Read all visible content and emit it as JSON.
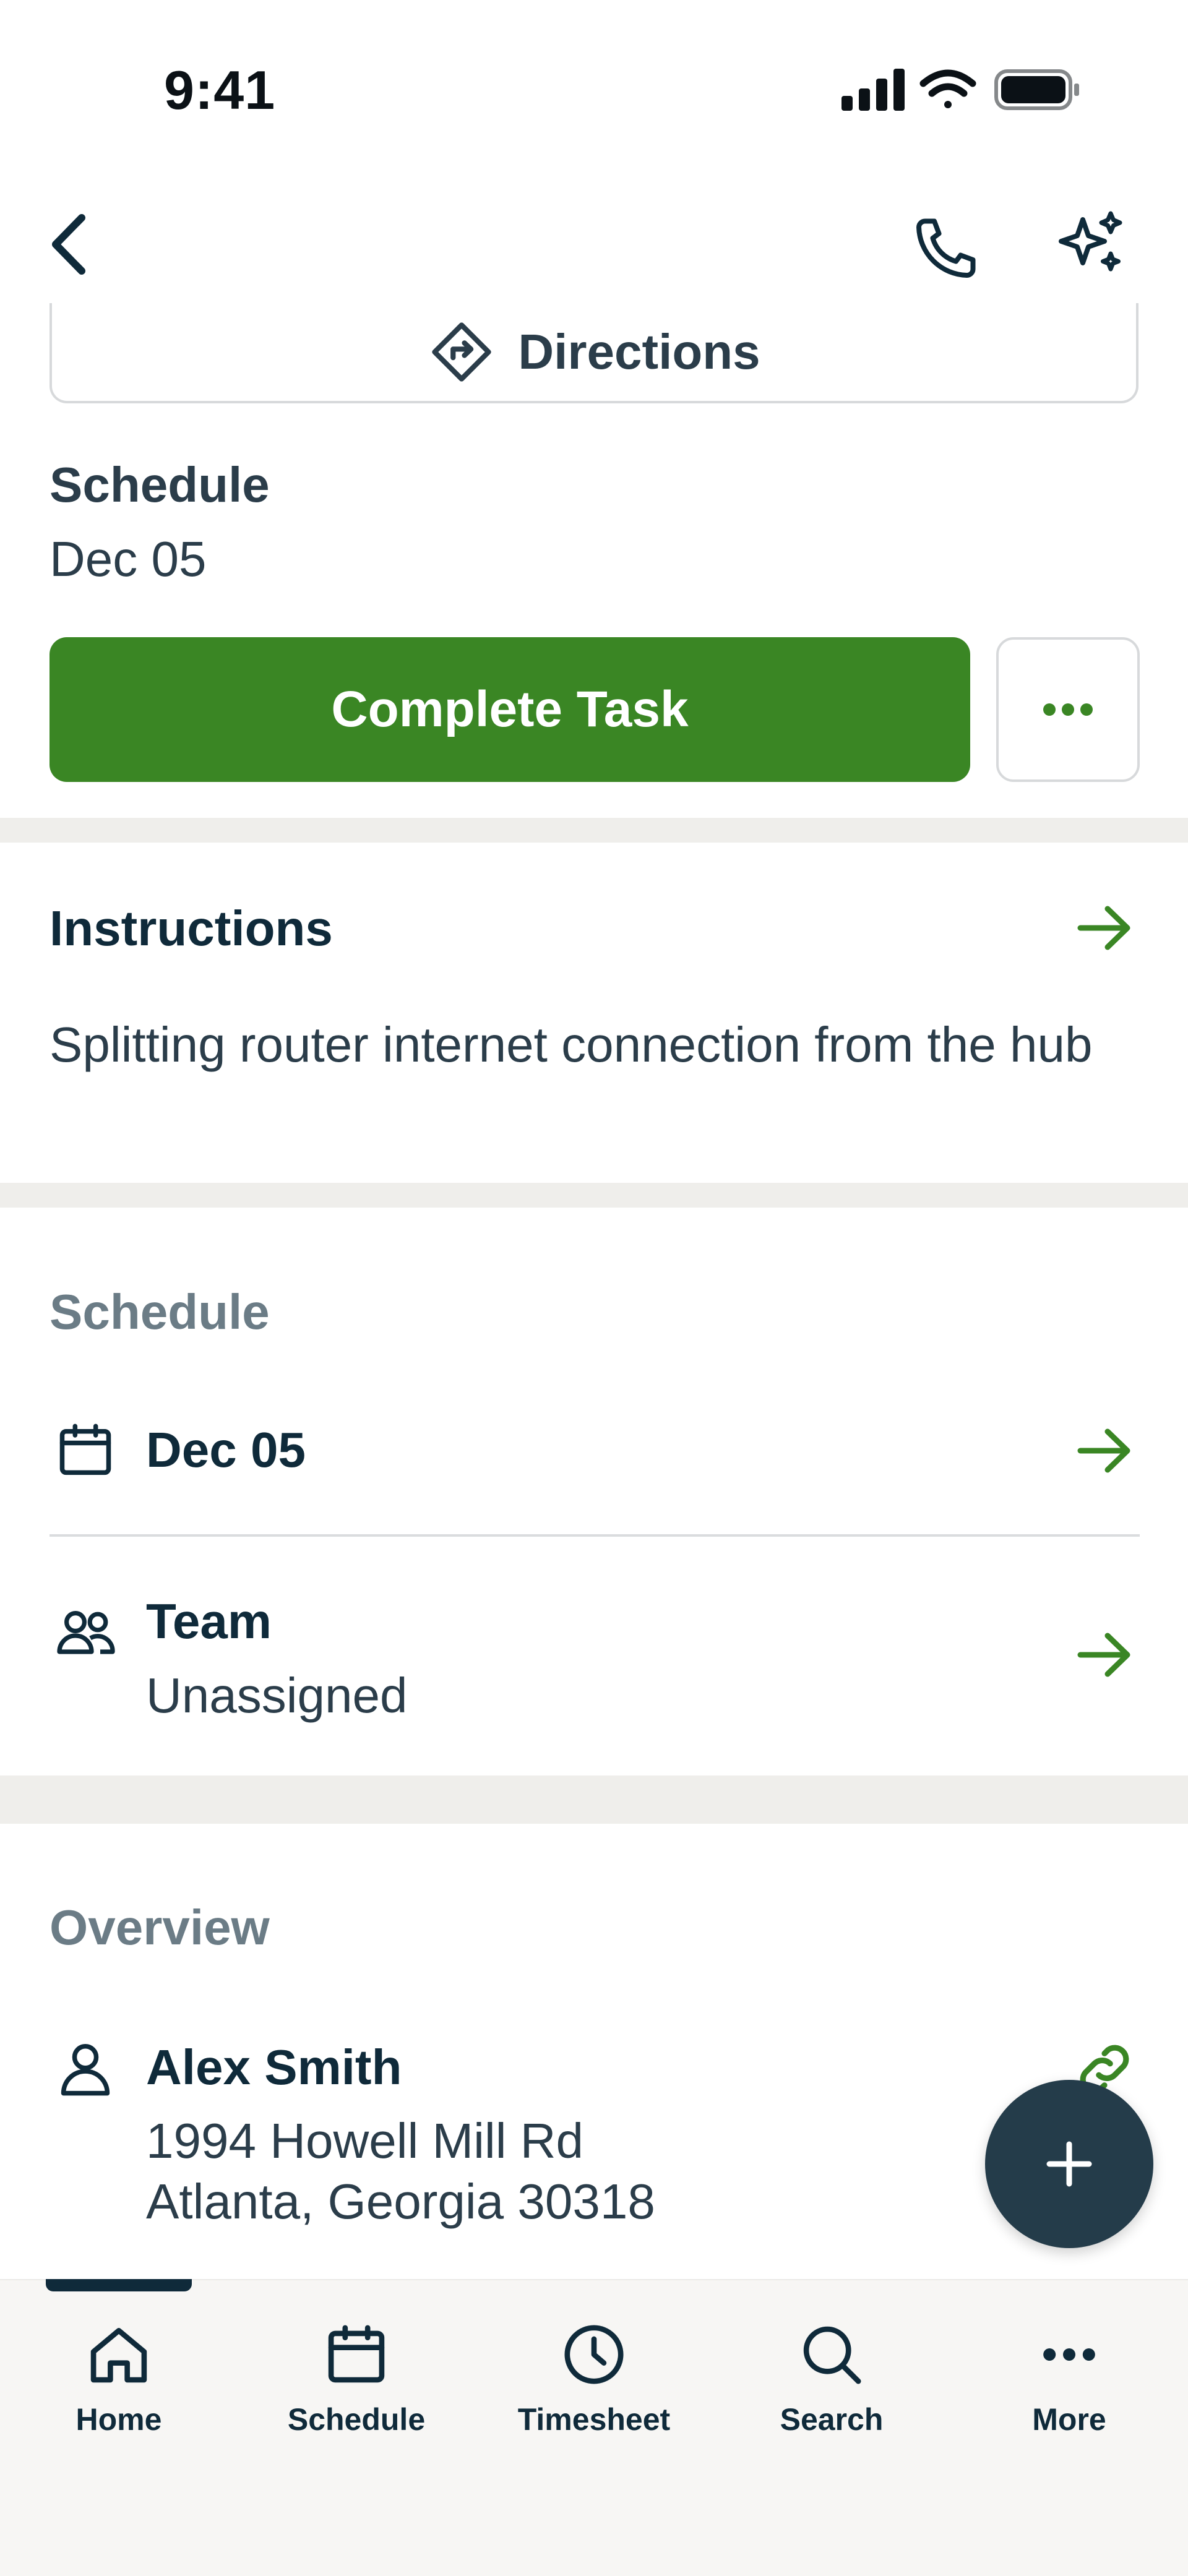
{
  "status_bar": {
    "time": "9:41"
  },
  "header": {
    "back_icon": "chevron-left-icon",
    "phone_icon": "phone-icon",
    "sparkles_icon": "sparkles-icon"
  },
  "directions": {
    "label": "Directions",
    "icon": "directions-icon"
  },
  "schedule_summary": {
    "label": "Schedule",
    "value": "Dec 05"
  },
  "actions": {
    "complete_label": "Complete Task",
    "more_icon": "ellipsis-icon",
    "accent": "#3a8624"
  },
  "instructions": {
    "title": "Instructions",
    "text": "Splitting router internet connection from the hub"
  },
  "schedule_section": {
    "heading": "Schedule",
    "date": "Dec 05",
    "team_label": "Team",
    "team_value": "Unassigned"
  },
  "overview": {
    "heading": "Overview",
    "client_name": "Alex Smith",
    "address_line1": "1994 Howell Mill Rd",
    "address_line2": "Atlanta, Georgia 30318"
  },
  "fab": {
    "icon": "plus-icon"
  },
  "tabbar": {
    "items": [
      {
        "label": "Home",
        "icon": "home-icon"
      },
      {
        "label": "Schedule",
        "icon": "calendar-icon"
      },
      {
        "label": "Timesheet",
        "icon": "clock-icon"
      },
      {
        "label": "Search",
        "icon": "search-icon"
      },
      {
        "label": "More",
        "icon": "ellipsis-icon"
      }
    ]
  }
}
